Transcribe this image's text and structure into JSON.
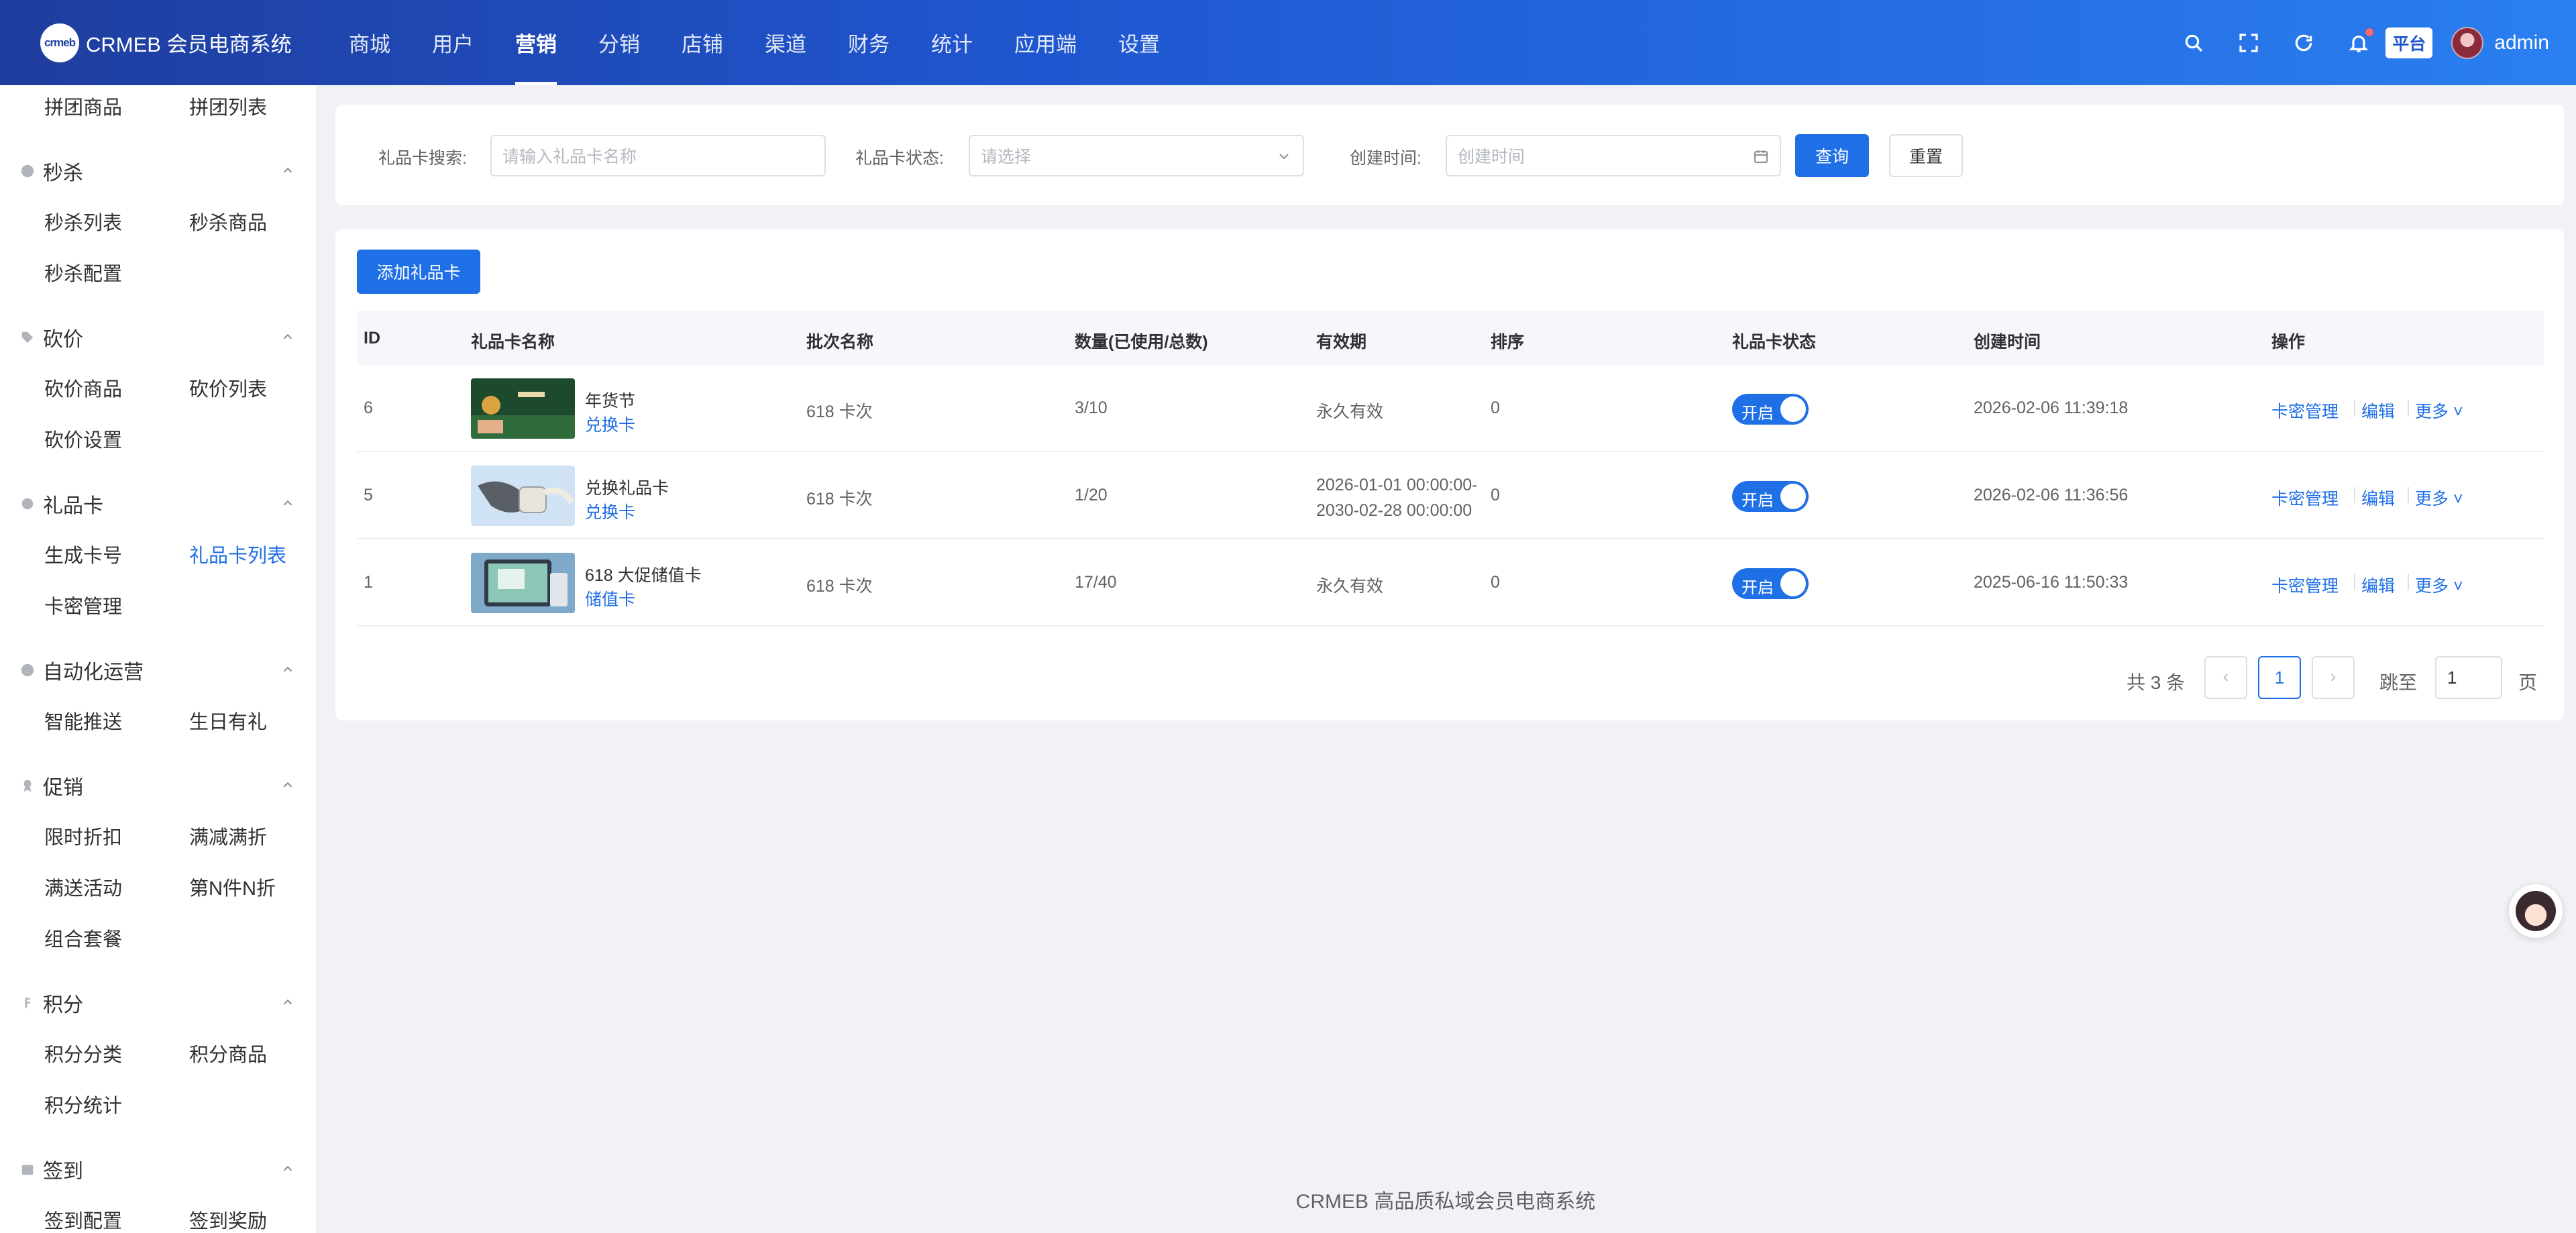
{
  "brand": {
    "logo_text": "crmeb",
    "title": "CRMEB 会员电商系统"
  },
  "nav": [
    "商城",
    "用户",
    "营销",
    "分销",
    "店铺",
    "渠道",
    "财务",
    "统计",
    "应用端",
    "设置"
  ],
  "nav_active": "营销",
  "top_tools": {
    "platform": "平台",
    "user": "admin"
  },
  "sidebar": {
    "top_items": [
      "拼团商品",
      "拼团列表"
    ],
    "groups": [
      {
        "title": "秒杀",
        "icon": "clock-icon",
        "items": [
          "秒杀列表",
          "秒杀商品",
          "秒杀配置"
        ]
      },
      {
        "title": "砍价",
        "icon": "tag-icon",
        "items": [
          "砍价商品",
          "砍价列表",
          "砍价设置"
        ]
      },
      {
        "title": "礼品卡",
        "icon": "gear-icon",
        "items": [
          "生成卡号",
          "礼品卡列表",
          "卡密管理"
        ],
        "active": "礼品卡列表"
      },
      {
        "title": "自动化运营",
        "icon": "robot-icon",
        "items": [
          "智能推送",
          "生日有礼"
        ]
      },
      {
        "title": "促销",
        "icon": "medal-icon",
        "items": [
          "限时折扣",
          "满减满折",
          "满送活动",
          "第N件N折",
          "组合套餐"
        ]
      },
      {
        "title": "积分",
        "icon": "coin-icon",
        "items": [
          "积分分类",
          "积分商品",
          "积分统计"
        ]
      },
      {
        "title": "签到",
        "icon": "calendar-icon",
        "items": [
          "签到配置",
          "签到奖励"
        ]
      }
    ]
  },
  "filter": {
    "search_label": "礼品卡搜索:",
    "search_placeholder": "请输入礼品卡名称",
    "status_label": "礼品卡状态:",
    "status_placeholder": "请选择",
    "time_label": "创建时间:",
    "time_placeholder": "创建时间",
    "query_button": "查询",
    "reset_button": "重置"
  },
  "add_button": "添加礼品卡",
  "table": {
    "columns": [
      "ID",
      "礼品卡名称",
      "批次名称",
      "数量(已使用/总数)",
      "有效期",
      "排序",
      "礼品卡状态",
      "创建时间",
      "操作"
    ],
    "rows": [
      {
        "id": "6",
        "name": "年货节",
        "type": "兑换卡",
        "batch": "618 卡次",
        "qty": "3/10",
        "validity": "永久有效",
        "sort": "0",
        "status": "开启",
        "created": "2026-02-06 11:39:18",
        "thumb": "green-forest"
      },
      {
        "id": "5",
        "name": "兑换礼品卡",
        "type": "兑换卡",
        "batch": "618 卡次",
        "qty": "1/20",
        "validity": "2026-01-01 00:00:00-\n2030-02-28 00:00:00",
        "sort": "0",
        "status": "开启",
        "created": "2026-02-06 11:36:56",
        "thumb": "smartwatch"
      },
      {
        "id": "1",
        "name": "618 大促储值卡",
        "type": "储值卡",
        "batch": "618 卡次",
        "qty": "17/40",
        "validity": "永久有效",
        "sort": "0",
        "status": "开启",
        "created": "2025-06-16 11:50:33",
        "thumb": "tablet"
      }
    ],
    "actions": [
      "卡密管理",
      "编辑",
      "更多"
    ]
  },
  "pagination": {
    "total": "共 3 条",
    "current": "1",
    "jump_label": "跳至",
    "jump_value": "1",
    "page_suffix": "页"
  },
  "footer": "CRMEB 高品质私域会员电商系统",
  "colors": {
    "primary": "#1f6fe6",
    "topbar_start": "#1f3d9e",
    "topbar_end": "#2a7ff0"
  }
}
